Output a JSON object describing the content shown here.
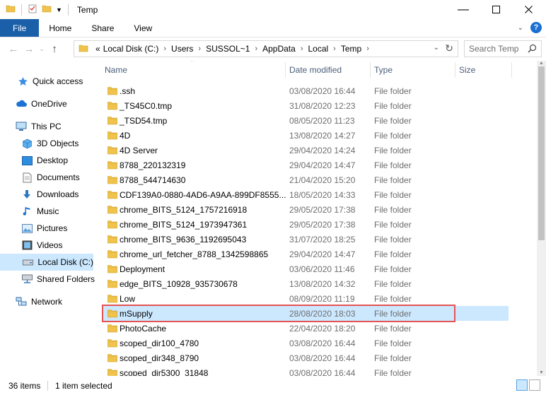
{
  "window": {
    "title": "Temp"
  },
  "ribbon": {
    "tabs": [
      "File",
      "Home",
      "Share",
      "View"
    ]
  },
  "address": {
    "crumbs": [
      "Local Disk (C:)",
      "Users",
      "SUSSOL~1",
      "AppData",
      "Local",
      "Temp"
    ],
    "prefix": "«"
  },
  "search": {
    "placeholder": "Search Temp"
  },
  "nav": {
    "quick_access": "Quick access",
    "onedrive": "OneDrive",
    "this_pc": "This PC",
    "objects3d": "3D Objects",
    "desktop": "Desktop",
    "documents": "Documents",
    "downloads": "Downloads",
    "music": "Music",
    "pictures": "Pictures",
    "videos": "Videos",
    "local_disk": "Local Disk (C:)",
    "shared_folders": "Shared Folders",
    "network": "Network"
  },
  "columns": {
    "name": "Name",
    "date": "Date modified",
    "type": "Type",
    "size": "Size"
  },
  "files": [
    {
      "name": ".ssh",
      "date": "03/08/2020 16:44",
      "type": "File folder"
    },
    {
      "name": "_TS45C0.tmp",
      "date": "31/08/2020 12:23",
      "type": "File folder"
    },
    {
      "name": "_TSD54.tmp",
      "date": "08/05/2020 11:23",
      "type": "File folder"
    },
    {
      "name": "4D",
      "date": "13/08/2020 14:27",
      "type": "File folder"
    },
    {
      "name": "4D Server",
      "date": "29/04/2020 14:24",
      "type": "File folder"
    },
    {
      "name": "8788_220132319",
      "date": "29/04/2020 14:47",
      "type": "File folder"
    },
    {
      "name": "8788_544714630",
      "date": "21/04/2020 15:20",
      "type": "File folder"
    },
    {
      "name": "CDF139A0-0880-4AD6-A9AA-899DF8555...",
      "date": "18/05/2020 14:33",
      "type": "File folder"
    },
    {
      "name": "chrome_BITS_5124_1757216918",
      "date": "29/05/2020 17:38",
      "type": "File folder"
    },
    {
      "name": "chrome_BITS_5124_1973947361",
      "date": "29/05/2020 17:38",
      "type": "File folder"
    },
    {
      "name": "chrome_BITS_9636_1192695043",
      "date": "31/07/2020 18:25",
      "type": "File folder"
    },
    {
      "name": "chrome_url_fetcher_8788_1342598865",
      "date": "29/04/2020 14:47",
      "type": "File folder"
    },
    {
      "name": "Deployment",
      "date": "03/06/2020 11:46",
      "type": "File folder"
    },
    {
      "name": "edge_BITS_10928_935730678",
      "date": "13/08/2020 14:32",
      "type": "File folder"
    },
    {
      "name": "Low",
      "date": "08/09/2020 11:19",
      "type": "File folder"
    },
    {
      "name": "mSupply",
      "date": "28/08/2020 18:03",
      "type": "File folder",
      "selected": true
    },
    {
      "name": "PhotoCache",
      "date": "22/04/2020 18:20",
      "type": "File folder"
    },
    {
      "name": "scoped_dir100_4780",
      "date": "03/08/2020 16:44",
      "type": "File folder"
    },
    {
      "name": "scoped_dir348_8790",
      "date": "03/08/2020 16:44",
      "type": "File folder"
    },
    {
      "name": "scoped_dir5300_31848",
      "date": "03/08/2020 16:44",
      "type": "File folder"
    }
  ],
  "status": {
    "count": "36 items",
    "selection": "1 item selected"
  },
  "colors": {
    "accent": "#1a5fa8",
    "selection": "#cce8ff",
    "folder": "#f0c44c",
    "focus": "#e55353"
  }
}
